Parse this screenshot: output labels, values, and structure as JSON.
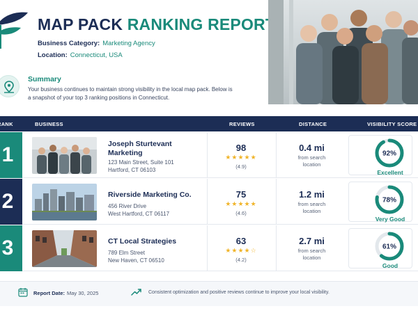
{
  "header": {
    "title_part1": "MAP PACK",
    "title_part2": "RANKING REPORT",
    "category_label": "Business Category:",
    "category_value": "Marketing Agency",
    "location_label": "Location:",
    "location_value": "Connecticut, USA"
  },
  "summary": {
    "icon": "map-pin-icon",
    "title": "Summary",
    "text": "Your business continues to maintain strong visibility in the local map pack. Below is a snapshot of your top 3 ranking positions in Connecticut."
  },
  "table": {
    "headers": [
      "RANK",
      "BUSINESS",
      "REVIEWS",
      "DISTANCE",
      "VISIBILITY SCORE"
    ],
    "rows": [
      {
        "rank": "1",
        "rank_color": "#1a8a7a",
        "name": "Joseph Sturtevant Marketing",
        "address1": "123 Main Street, Suite 101",
        "address2": "Hartford, CT 06103",
        "reviews": "98",
        "stars": "★★★★★",
        "rating": "(4.9)",
        "distance": "0.4 mi",
        "distance_note": "from search location",
        "score": "92%",
        "score_value": 0.92,
        "label": "Excellent",
        "thumb": "team-photo"
      },
      {
        "rank": "2",
        "rank_color": "#1c2d55",
        "name": "Riverside Marketing Co.",
        "address1": "456 River Drive",
        "address2": "West Hartford, CT 06117",
        "reviews": "75",
        "stars": "★★★★★",
        "rating": "(4.6)",
        "distance": "1.2 mi",
        "distance_note": "from search location",
        "score": "78%",
        "score_value": 0.78,
        "label": "Very Good",
        "thumb": "skyline-photo"
      },
      {
        "rank": "3",
        "rank_color": "#1a8a7a",
        "name": "CT Local Strategies",
        "address1": "789 Elm Street",
        "address2": "New Haven, CT 06510",
        "reviews": "63",
        "stars": "★★★★☆",
        "rating": "(4.2)",
        "distance": "2.7 mi",
        "distance_note": "from search location",
        "score": "61%",
        "score_value": 0.61,
        "label": "Good",
        "thumb": "street-photo"
      }
    ]
  },
  "footer": {
    "date_label": "Report Date:",
    "date_value": "May 30, 2025",
    "note": "Consistent optimization and positive reviews continue to improve your local visibility."
  },
  "colors": {
    "navy": "#1c2d55",
    "teal": "#1a8a7a",
    "star": "#f0b429"
  }
}
